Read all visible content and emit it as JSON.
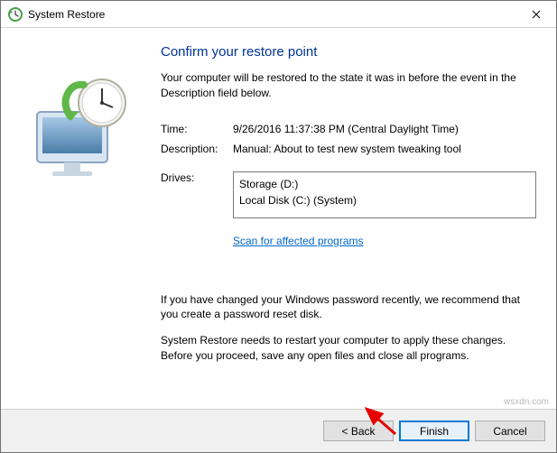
{
  "window": {
    "title": "System Restore",
    "close_tooltip": "Close"
  },
  "content": {
    "heading": "Confirm your restore point",
    "subtext": "Your computer will be restored to the state it was in before the event in the Description field below.",
    "time_label": "Time:",
    "time_value": "9/26/2016 11:37:38 PM (Central Daylight Time)",
    "description_label": "Description:",
    "description_value": "Manual: About to test new system tweaking tool",
    "drives_label": "Drives:",
    "drives": [
      "Storage (D:)",
      "Local Disk (C:) (System)"
    ],
    "scan_link": "Scan for affected programs",
    "password_notice": "If you have changed your Windows password recently, we recommend that you create a password reset disk.",
    "restart_notice": "System Restore needs to restart your computer to apply these changes. Before you proceed, save any open files and close all programs."
  },
  "footer": {
    "back": "< Back",
    "finish": "Finish",
    "cancel": "Cancel"
  },
  "watermark": "wsxdn.com"
}
